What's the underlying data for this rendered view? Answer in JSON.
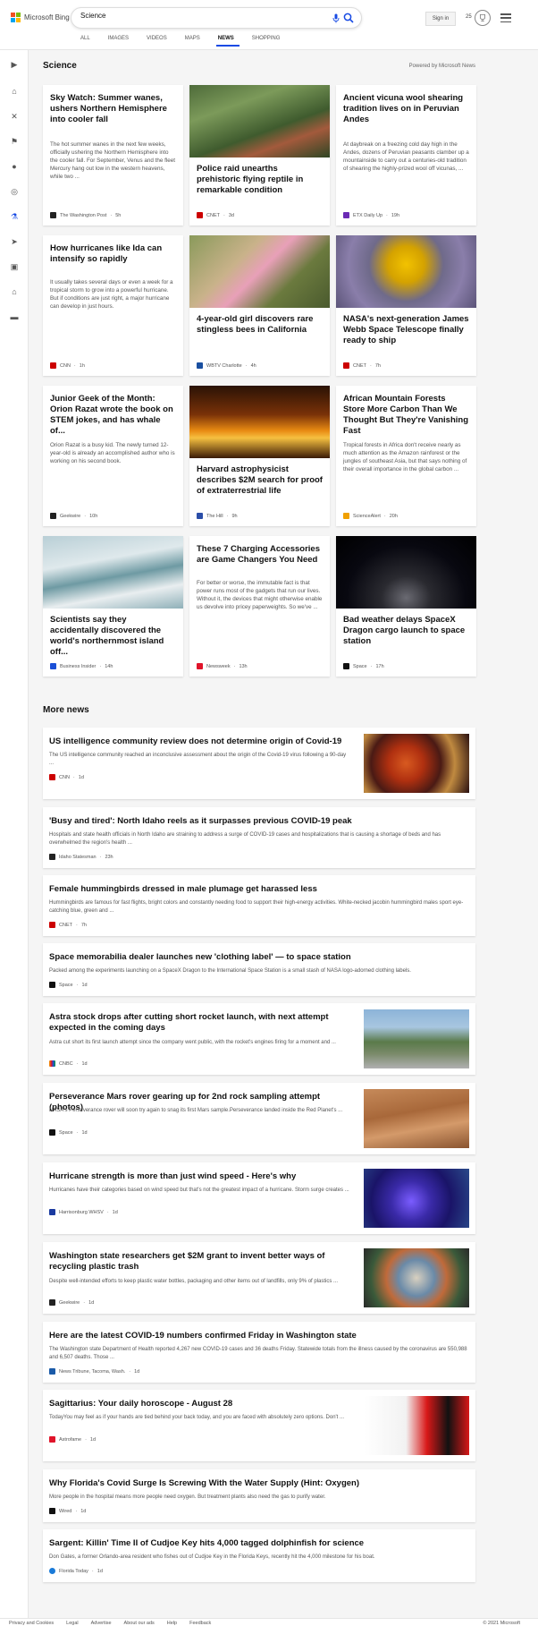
{
  "header": {
    "brand": "Microsoft Bing",
    "search_value": "Science",
    "signin": "Sign in",
    "rewards_count": "25",
    "tabs": [
      "ALL",
      "IMAGES",
      "VIDEOS",
      "MAPS",
      "NEWS",
      "SHOPPING"
    ],
    "active_tab": "NEWS"
  },
  "section": {
    "title": "Science",
    "powered": "Powered by Microsoft News"
  },
  "cards": [
    {
      "title": "Sky Watch: Summer wanes, ushers Northern Hemisphere into cooler fall",
      "desc": "The hot summer wanes in the next few weeks, officially ushering the Northern Hemisphere into the cooler fall. For September, Venus and the fleet Mercury hang out low in the western heavens, while two ...",
      "source": "The Washington Post",
      "time": "5h"
    },
    {
      "title": "Police raid unearths prehistoric flying reptile in remarkable condition",
      "source": "CNET",
      "time": "3d"
    },
    {
      "title": "Ancient vicuna wool shearing tradition lives on in Peruvian Andes",
      "desc": "At daybreak on a freezing cold day high in the Andes, dozens of Peruvian peasants clamber up a mountainside to carry out a centuries-old tradition of shearing the highly-prized wool off vicunas, ...",
      "source": "ETX Daily Up",
      "time": "19h"
    },
    {
      "title": "How hurricanes like Ida can intensify so rapidly",
      "desc": "It usually takes several days or even a week for a tropical storm to grow into a powerful hurricane. But if conditions are just right, a major hurricane can develop in just hours.",
      "source": "CNN",
      "time": "1h"
    },
    {
      "title": "4-year-old girl discovers rare stingless bees in California",
      "source": "WBTV Charlotte",
      "time": "4h"
    },
    {
      "title": "NASA's next-generation James Webb Space Telescope finally ready to ship",
      "source": "CNET",
      "time": "7h"
    },
    {
      "title": "Junior Geek of the Month: Orion Razat wrote the book on STEM jokes, and has whale of...",
      "desc": "Orion Razat is a busy kid. The newly turned 12-year-old is already an accomplished author who is working on his second book.",
      "source": "Geekwire",
      "time": "10h"
    },
    {
      "title": "Harvard astrophysicist describes $2M search for proof of extraterrestrial life",
      "source": "The Hill",
      "time": "9h"
    },
    {
      "title": "African Mountain Forests Store More Carbon Than We Thought But They're Vanishing Fast",
      "desc": "Tropical forests in Africa don't receive nearly as much attention as the Amazon rainforest or the jungles of southeast Asia, but that says nothing of their overall importance in the global carbon ...",
      "source": "ScienceAlert",
      "time": "20h"
    },
    {
      "title": "Scientists say they accidentally discovered the world's northernmost island off...",
      "source": "Business Insider",
      "time": "14h"
    },
    {
      "title": "These 7 Charging Accessories are Game Changers You Need",
      "desc": "For better or worse, the immutable fact is that power runs most of the gadgets that run our lives. Without it, the devices that might otherwise enable us devolve into pricey paperweights. So we've ...",
      "source": "Newsweek",
      "time": "13h"
    },
    {
      "title": "Bad weather delays SpaceX Dragon cargo launch to space station",
      "source": "Space",
      "time": "17h"
    }
  ],
  "more": {
    "title": "More news",
    "items": [
      {
        "title": "US intelligence community review does not determine origin of Covid-19",
        "desc": "The US intelligence community reached an inconclusive assessment about the origin of the Covid-19 virus following a 90-day ...",
        "source": "CNN",
        "time": "1d"
      },
      {
        "title": "'Busy and tired': North Idaho reels as it surpasses previous COVID-19 peak",
        "desc": "Hospitals and state health officials in North Idaho are straining to address a surge of COVID-19 cases and hospitalizations that is causing a shortage of beds and has overwhelmed the region's health ...",
        "source": "Idaho Statesman",
        "time": "23h"
      },
      {
        "title": "Female hummingbirds dressed in male plumage get harassed less",
        "desc": "Hummingbirds are famous for fast flights, bright colors and constantly needing food to support their high-energy activities. White-necked jacobin hummingbird males sport eye-catching blue, green and ...",
        "source": "CNET",
        "time": "7h"
      },
      {
        "title": "Space memorabilia dealer launches new 'clothing label' — to space station",
        "desc": "Packed among the experiments launching on a SpaceX Dragon to the International Space Station is a small stash of NASA logo-adorned clothing labels.",
        "source": "Space",
        "time": "1d"
      },
      {
        "title": "Astra stock drops after cutting short rocket launch, with next attempt expected in the coming days",
        "desc": "Astra cut short its first launch attempt since the company went public, with the rocket's engines firing for a moment and ...",
        "source": "CNBC",
        "time": "1d"
      },
      {
        "title": "Perseverance Mars rover gearing up for 2nd rock sampling attempt (photos)",
        "desc": "NASA's Perseverance rover will soon try again to snag its first Mars sample.Perseverance landed inside the Red Planet's ...",
        "source": "Space",
        "time": "1d"
      },
      {
        "title": "Hurricane strength is more than just wind speed - Here's why",
        "desc": "Hurricanes have their categories based on wind speed but that's not the greatest impact of a hurricane. Storm surge creates ...",
        "source": "Harrisonburg WHSV",
        "time": "1d"
      },
      {
        "title": "Washington state researchers get $2M grant to invent better ways of recycling plastic trash",
        "desc": "Despite well-intended efforts to keep plastic water bottles, packaging and other items out of landfills, only 9% of plastics ...",
        "source": "Geekwire",
        "time": "1d"
      },
      {
        "title": "Here are the latest COVID-19 numbers confirmed Friday in Washington state",
        "desc": "The Washington state Department of Health reported 4,267 new COVID-19 cases and 36 deaths Friday. Statewide totals from the illness caused by the coronavirus are 550,988 and 6,507 deaths. Those ...",
        "source": "News Tribune, Tacoma, Wash.",
        "time": "1d"
      },
      {
        "title": "Sagittarius: Your daily horoscope - August 28",
        "desc": "TodayYou may feel as if your hands are tied behind your back today, and you are faced with absolutely zero options. Don't ...",
        "source": "Astrofame",
        "time": "1d"
      },
      {
        "title": "Why Florida's Covid Surge Is Screwing With the Water Supply (Hint: Oxygen)",
        "desc": "More people in the hospital means more people need oxygen. But treatment plants also need the gas to purify water.",
        "source": "Wired",
        "time": "1d"
      },
      {
        "title": "Sargent: Killin' Time II of Cudjoe Key hits 4,000 tagged dolphinfish for science",
        "desc": "Don Gates, a former Orlando-area resident who fishes out of Cudjoe Key in the Florida Keys, recently hit the 4,000 milestone for his boat.",
        "source": "Florida Today",
        "time": "1d"
      }
    ]
  },
  "footer": {
    "links": [
      "Privacy and Cookies",
      "Legal",
      "Advertise",
      "About our ads",
      "Help",
      "Feedback"
    ],
    "copyright": "© 2021 Microsoft"
  }
}
